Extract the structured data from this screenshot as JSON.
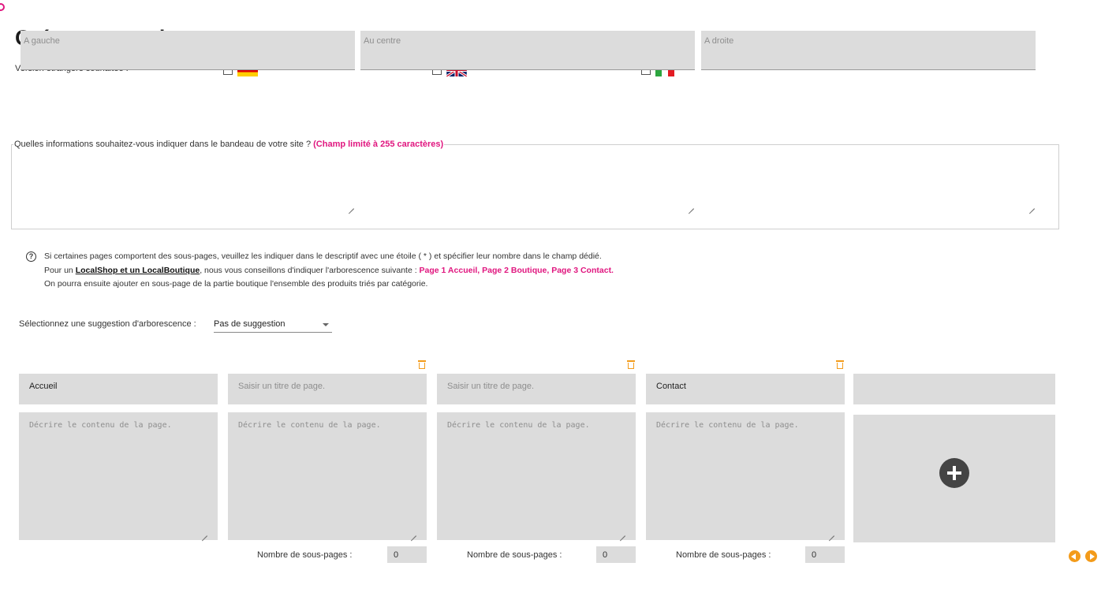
{
  "title": "Créez votre arborescence",
  "languages": {
    "label": "Version étrangère souhaitée :",
    "options": [
      {
        "flag": "flag-germany",
        "checked": false
      },
      {
        "flag": "flag-united-kingdom",
        "checked": false
      },
      {
        "flag": "flag-italy",
        "checked": false
      }
    ]
  },
  "banner": {
    "legend": "Quelles informations souhaitez-vous indiquer dans le bandeau de votre site ?",
    "legend_limit": "(Champ limité à 255 caractères)",
    "fields": [
      {
        "placeholder": "A gauche",
        "value": ""
      },
      {
        "placeholder": "Au centre",
        "value": ""
      },
      {
        "placeholder": "A droite",
        "value": ""
      }
    ]
  },
  "info": {
    "icon": "question-circle-icon",
    "line1": "Si certaines pages comportent des sous-pages, veuillez les indiquer dans le descriptif avec une étoile ( * ) et spécifier leur nombre dans le champ dédié.",
    "line2_prefix": "Pour un ",
    "line2_link": "LocalShop et un LocalBoutique",
    "line2_middle": ", nous vous conseillons d'indiquer l'arborescence suivante : ",
    "line2_highlight": "Page 1 Accueil, Page 2 Boutique, Page 3 Contact.",
    "line3": "On pourra ensuite ajouter en sous-page de la partie boutique l'ensemble des produits triés par catégorie."
  },
  "suggestion": {
    "label": "Sélectionnez une suggestion d'arborescence :",
    "selected": "Pas de suggestion"
  },
  "pages": [
    {
      "title": "Accueil",
      "title_placeholder": "Saisir un titre de page.",
      "description_placeholder": "Décrire le contenu de la page.",
      "has_subpages_field": false,
      "deletable": false
    },
    {
      "title": "",
      "title_placeholder": "Saisir un titre de page.",
      "description_placeholder": "Décrire le contenu de la page.",
      "has_subpages_field": true,
      "subpages_label": "Nombre de sous-pages :",
      "subpages_count": "0",
      "deletable": true
    },
    {
      "title": "",
      "title_placeholder": "Saisir un titre de page.",
      "description_placeholder": "Décrire le contenu de la page.",
      "has_subpages_field": true,
      "subpages_label": "Nombre de sous-pages :",
      "subpages_count": "0",
      "deletable": true
    },
    {
      "title": "Contact",
      "title_placeholder": "Saisir un titre de page.",
      "description_placeholder": "Décrire le contenu de la page.",
      "has_subpages_field": true,
      "subpages_label": "Nombre de sous-pages :",
      "subpages_count": "0",
      "deletable": true
    }
  ],
  "add_page": {
    "icon": "plus-circle-icon"
  },
  "pagination": {
    "prev_icon": "chevron-left-circle-icon",
    "next_icon": "chevron-right-circle-icon"
  },
  "colors": {
    "accent_pink": "#e0167f",
    "accent_orange": "#f39b1a",
    "field_gray": "#dcdcdc"
  }
}
